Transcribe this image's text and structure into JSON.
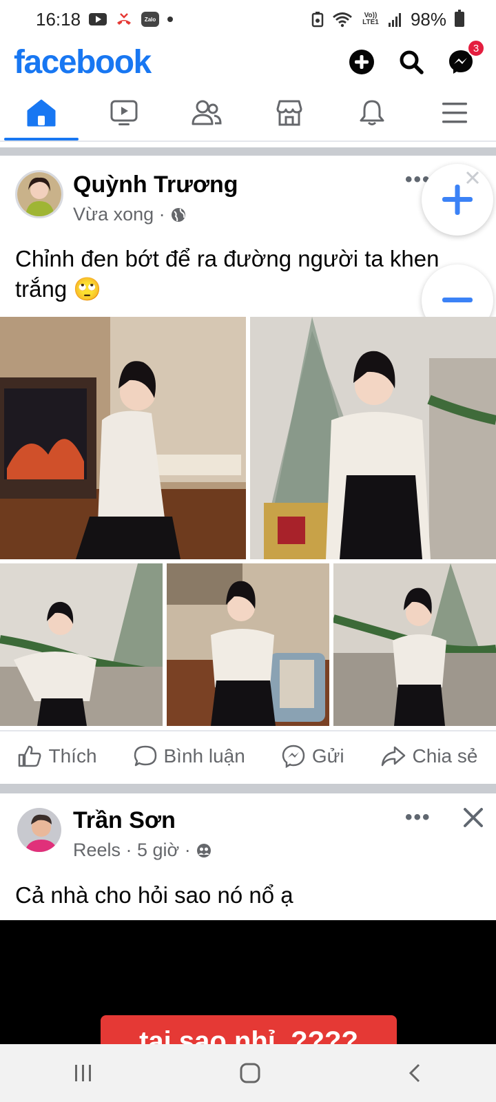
{
  "status_bar": {
    "time": "16:18",
    "zalo_label": "Zalo",
    "volte_label": "Vo)) LTE1",
    "battery": "98%"
  },
  "header": {
    "brand": "facebook",
    "messenger_badge": "3"
  },
  "tabs": [
    "home",
    "video",
    "friends",
    "marketplace",
    "notifications",
    "menu"
  ],
  "posts": [
    {
      "author": "Quỳnh Trương",
      "meta": "Vừa xong ·",
      "privacy_icon": "globe-icon",
      "text": "Chỉnh đen bớt để ra đường người ta khen trắng 🙄",
      "more": "•••",
      "photo_count_shown": 5
    },
    {
      "author": "Trần Sơn",
      "meta": "Reels · 5 giờ ·",
      "privacy_icon": "friends-icon",
      "text": "Cả nhà cho hỏi sao nó nổ ạ",
      "more": "•••",
      "video_caption": "tai sao nhỉ. ????"
    }
  ],
  "actions": {
    "like": "Thích",
    "comment": "Bình luận",
    "send": "Gửi",
    "share": "Chia sẻ"
  },
  "colors": {
    "brand": "#1877f2",
    "badge": "#e41e3f",
    "secondary_text": "#65676b"
  }
}
